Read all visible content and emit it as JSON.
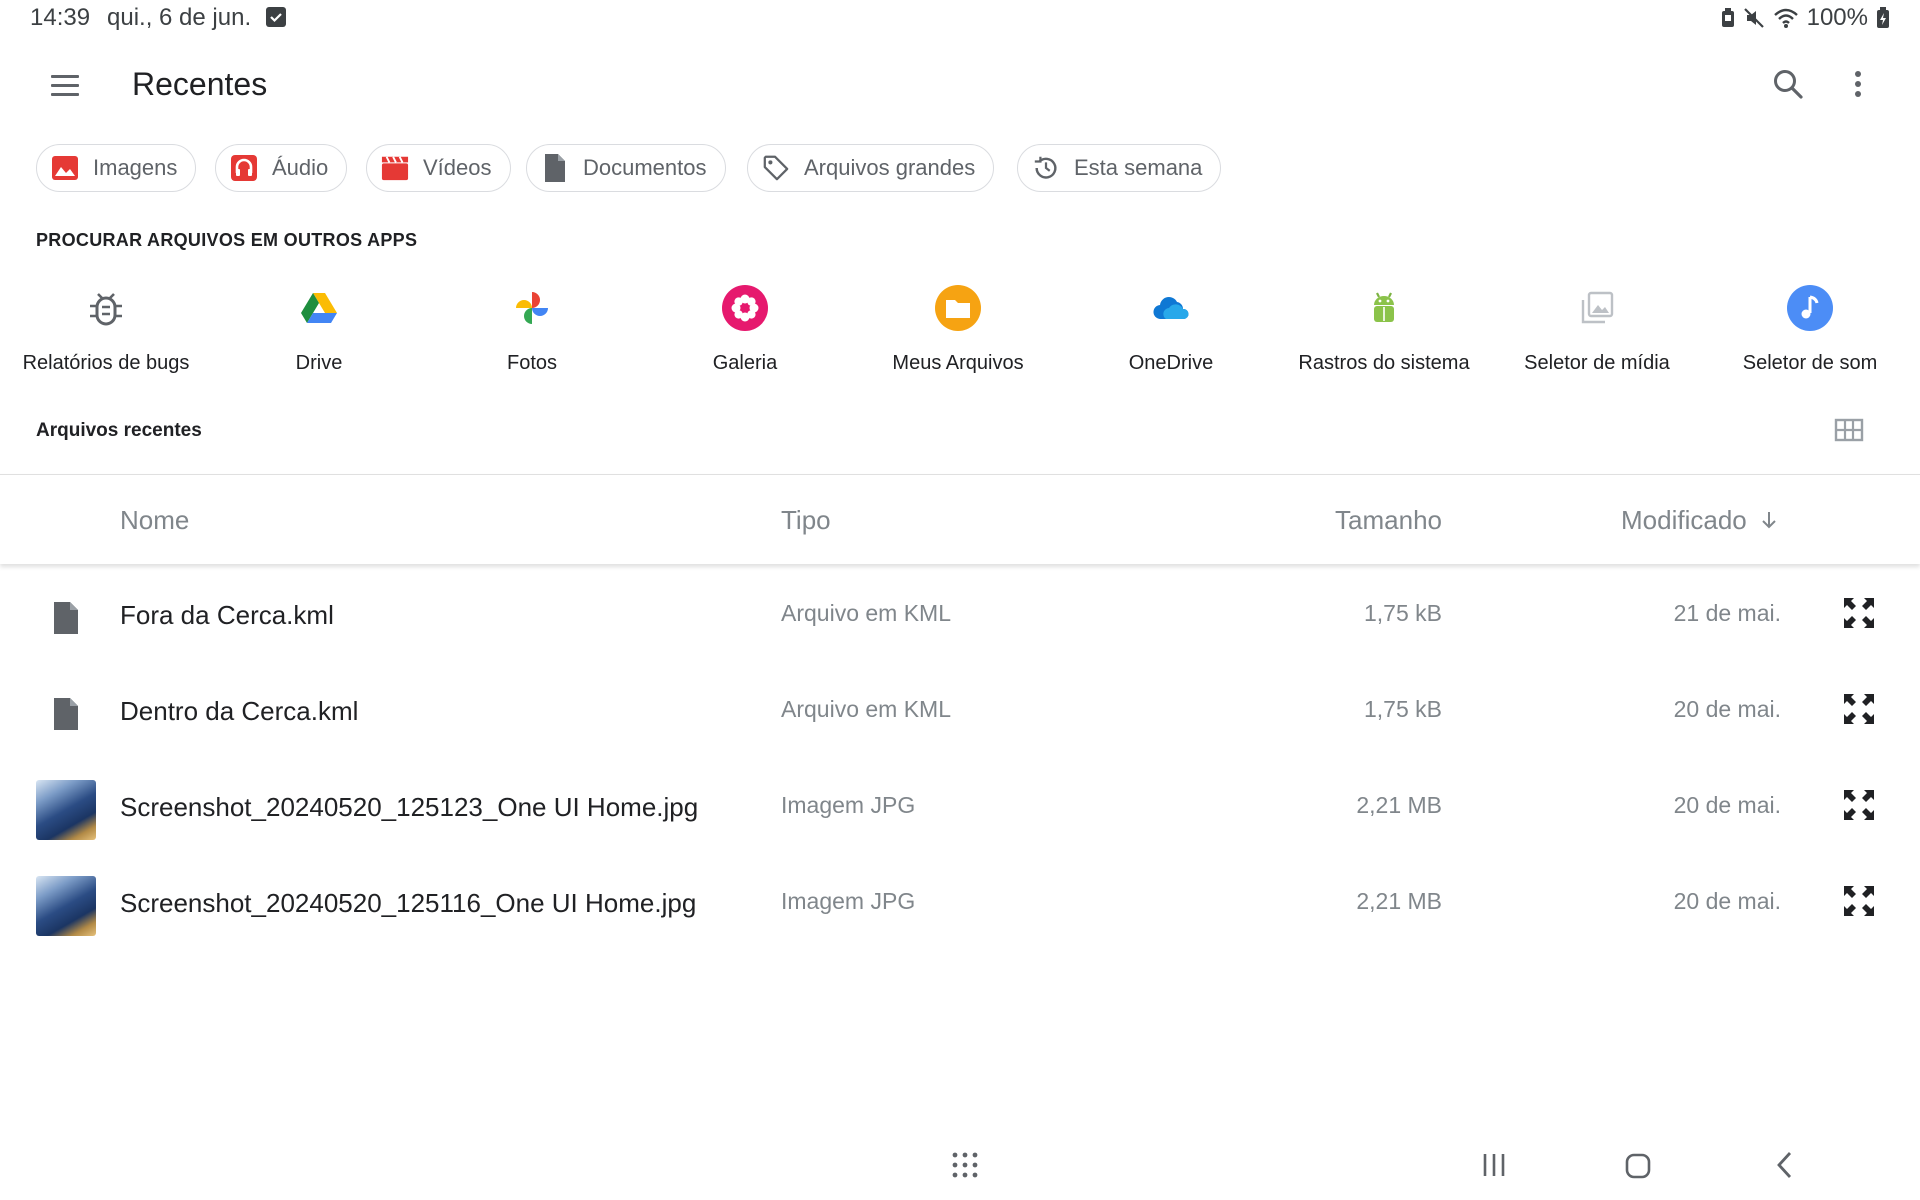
{
  "status_bar": {
    "time": "14:39",
    "date": "qui., 6 de jun.",
    "battery": "100%",
    "icons": [
      "checkbox-icon",
      "battery-saver-icon",
      "mute-icon",
      "wifi-icon",
      "battery-icon"
    ]
  },
  "app_bar": {
    "title": "Recentes",
    "menu_icon": "hamburger-menu-icon",
    "search_icon": "search-icon",
    "more_icon": "more-vertical-icon"
  },
  "chips": [
    {
      "label": "Imagens",
      "icon": "image-icon",
      "color": "#e53935"
    },
    {
      "label": "Áudio",
      "icon": "headphones-icon",
      "color": "#e53935"
    },
    {
      "label": "Vídeos",
      "icon": "clapperboard-icon",
      "color": "#e53935"
    },
    {
      "label": "Documentos",
      "icon": "document-icon",
      "color": "#5f6368"
    },
    {
      "label": "Arquivos grandes",
      "icon": "tag-icon",
      "color": "#5f6368"
    },
    {
      "label": "Esta semana",
      "icon": "history-icon",
      "color": "#5f6368"
    }
  ],
  "apps_section": {
    "heading": "PROCURAR ARQUIVOS EM OUTROS APPS",
    "apps": [
      {
        "label": "Relatórios de bugs",
        "icon": "bug-icon"
      },
      {
        "label": "Drive",
        "icon": "google-drive-icon"
      },
      {
        "label": "Fotos",
        "icon": "google-photos-icon"
      },
      {
        "label": "Galeria",
        "icon": "gallery-icon"
      },
      {
        "label": "Meus Arquivos",
        "icon": "my-files-icon"
      },
      {
        "label": "OneDrive",
        "icon": "onedrive-icon"
      },
      {
        "label": "Rastros do sistema",
        "icon": "android-trace-icon"
      },
      {
        "label": "Seletor de mídia",
        "icon": "media-picker-icon"
      },
      {
        "label": "Seletor de som",
        "icon": "sound-picker-icon"
      }
    ]
  },
  "recent_section": {
    "heading": "Arquivos recentes",
    "view_toggle_icon": "grid-view-icon"
  },
  "table": {
    "columns": {
      "name": "Nome",
      "type": "Tipo",
      "size": "Tamanho",
      "modified": "Modificado"
    },
    "sort_icon": "arrow-down-icon",
    "rows": [
      {
        "name": "Fora da Cerca.kml",
        "type": "Arquivo em KML",
        "size": "1,75 kB",
        "modified": "21 de mai.",
        "thumb": "file-icon"
      },
      {
        "name": "Dentro da Cerca.kml",
        "type": "Arquivo em KML",
        "size": "1,75 kB",
        "modified": "20 de mai.",
        "thumb": "file-icon"
      },
      {
        "name": "Screenshot_20240520_125123_One UI Home.jpg",
        "type": "Imagem JPG",
        "size": "2,21 MB",
        "modified": "20 de mai.",
        "thumb": "image-thumbnail"
      },
      {
        "name": "Screenshot_20240520_125116_One UI Home.jpg",
        "type": "Imagem JPG",
        "size": "2,21 MB",
        "modified": "20 de mai.",
        "thumb": "image-thumbnail"
      }
    ]
  },
  "nav_bar": {
    "icons": [
      "app-drawer-icon",
      "recents-icon",
      "home-icon",
      "back-icon"
    ]
  }
}
